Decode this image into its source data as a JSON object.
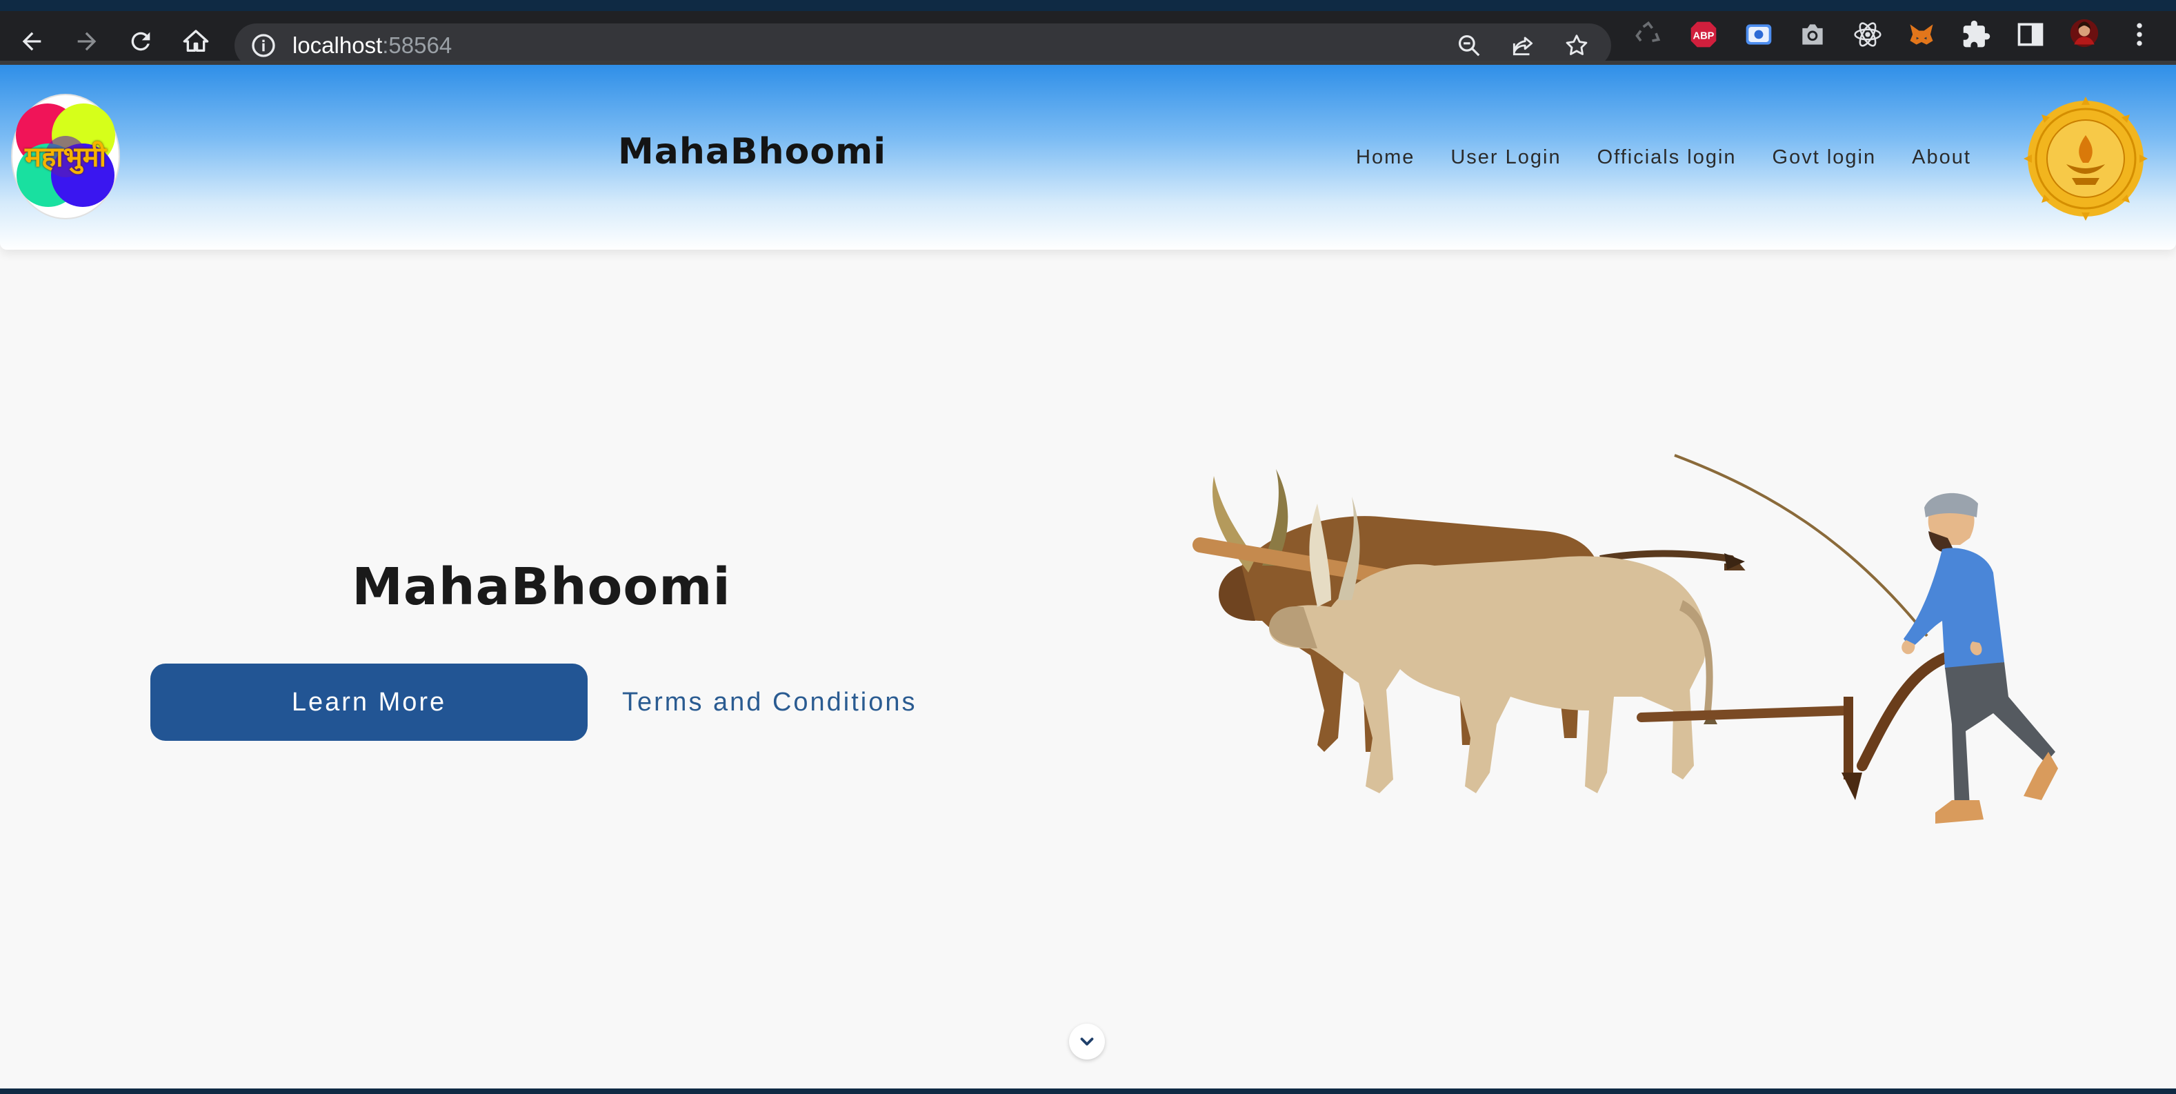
{
  "browser": {
    "url_host": "localhost",
    "url_port": ":58564",
    "icons": {
      "back": "arrow-left-icon",
      "forward": "arrow-right-icon",
      "reload": "reload-icon",
      "home": "home-icon",
      "site_info": "info-icon",
      "zoom": "zoom-out-icon",
      "share": "share-icon",
      "bookmark": "star-icon"
    },
    "extensions": [
      "recycle-icon",
      "adblock-icon",
      "screen-capture-icon",
      "camera-icon",
      "react-icon",
      "metamask-icon",
      "puzzle-icon",
      "sidepanel-icon",
      "profile-avatar",
      "menu-kebab-icon"
    ],
    "adblock_label": "ABP"
  },
  "header": {
    "logo_text": "महाभुमी",
    "brand": "MahaBhoomi",
    "nav": [
      "Home",
      "User Login",
      "Officials login",
      "Govt login",
      "About"
    ]
  },
  "hero": {
    "title": "MahaBhoomi",
    "primary_button": "Learn More",
    "secondary_link": "Terms and Conditions"
  },
  "colors": {
    "primary": "#225594",
    "header_gradient_top": "#2f8fe8",
    "chrome": "#202124",
    "page_bg": "#f8f8f8"
  }
}
